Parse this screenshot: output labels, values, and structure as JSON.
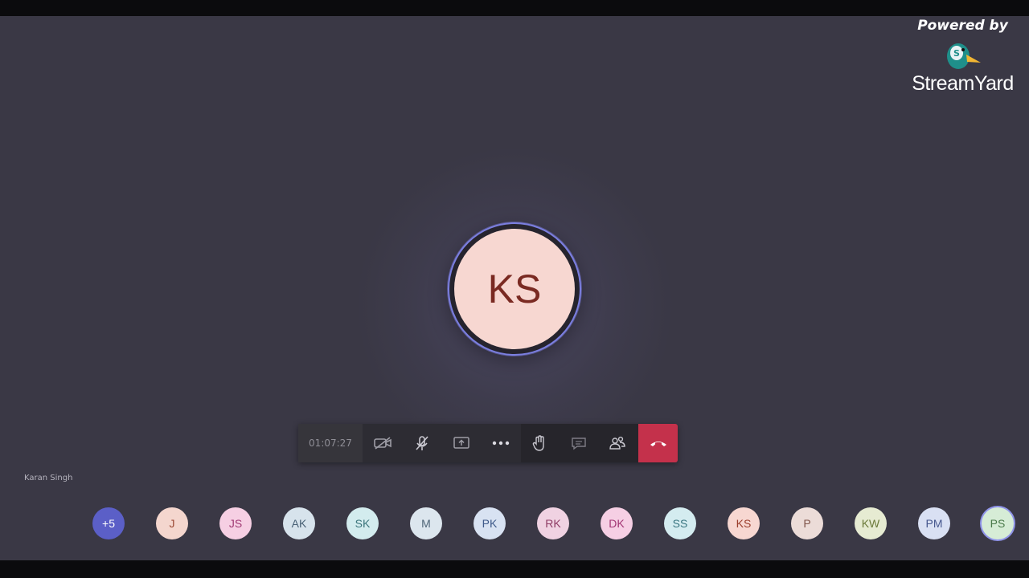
{
  "brand": {
    "powered_by": "Powered by",
    "name": "StreamYard"
  },
  "main_participant": {
    "initials": "KS",
    "name_label": "Karan Singh"
  },
  "toolbar": {
    "timer": "01:07:27",
    "icons": [
      "camera-off-icon",
      "mic-off-icon",
      "share-screen-icon",
      "more-options-icon",
      "raise-hand-icon",
      "chat-icon",
      "participants-icon",
      "hang-up-icon"
    ]
  },
  "participants": [
    {
      "initials": "+5",
      "bg": "#5b5fc7",
      "fg": "#ffffff"
    },
    {
      "initials": "J",
      "bg": "#f4d6ce",
      "fg": "#9b4a36"
    },
    {
      "initials": "JS",
      "bg": "#f6cfe3",
      "fg": "#a13a74"
    },
    {
      "initials": "AK",
      "bg": "#d7e3ec",
      "fg": "#4a6276"
    },
    {
      "initials": "SK",
      "bg": "#d3ecee",
      "fg": "#3c767c"
    },
    {
      "initials": "M",
      "bg": "#dce6ee",
      "fg": "#4f6678"
    },
    {
      "initials": "PK",
      "bg": "#d8e2f2",
      "fg": "#3f5a8a"
    },
    {
      "initials": "RK",
      "bg": "#f0d2e2",
      "fg": "#8f3d66"
    },
    {
      "initials": "DK",
      "bg": "#f6cfe4",
      "fg": "#a33775"
    },
    {
      "initials": "SS",
      "bg": "#d4ecf0",
      "fg": "#3a7681"
    },
    {
      "initials": "KS",
      "bg": "#f7d7d1",
      "fg": "#9b3f2d"
    },
    {
      "initials": "P",
      "bg": "#ecdcd8",
      "fg": "#80544a"
    },
    {
      "initials": "KW",
      "bg": "#e6ebd2",
      "fg": "#6b7a3a"
    },
    {
      "initials": "PM",
      "bg": "#d9e0f3",
      "fg": "#46578e"
    },
    {
      "initials": "PS",
      "bg": "#d6ecd6",
      "fg": "#4b7a4b"
    }
  ],
  "colors": {
    "stage_bg": "#3a3845",
    "toolbar_bg": "#2d2c33",
    "hangup": "#c4314b",
    "active_ring": "#8f93e8"
  }
}
